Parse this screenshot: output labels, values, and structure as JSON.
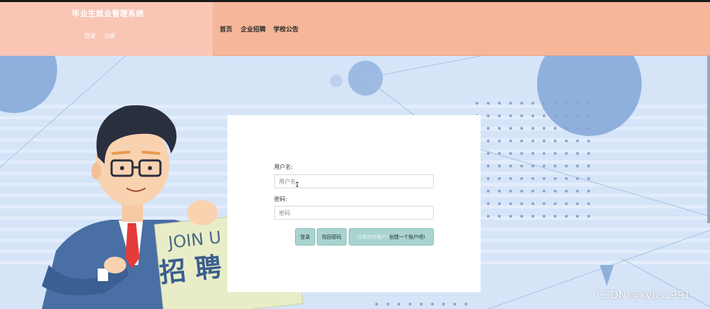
{
  "header": {
    "site_title": "毕业生就业管理系统",
    "auth": {
      "login_label": "登录",
      "register_label": "注册"
    },
    "nav": {
      "home": "首页",
      "jobs": "企业招聘",
      "notices": "学校公告"
    }
  },
  "banner": {
    "sign_text_en": "JOIN U",
    "sign_text_cn": "招 聘"
  },
  "login_form": {
    "username_label": "用户名:",
    "username_placeholder": "用户名",
    "username_value": "",
    "password_label": "密码:",
    "password_placeholder": "密码",
    "password_value": "",
    "login_button": "登录",
    "forgot_button": "找回密码",
    "register_prefix": "没有存在账户?",
    "register_link": "创建一个账户吧!"
  },
  "watermark": "CSDN @kybs1991",
  "colors": {
    "header_bg": "#f6b69a",
    "brand_panel_bg": "#f9c6b6",
    "page_bg": "#d6e4f8",
    "button_bg": "#a9d3cf",
    "card_bg": "#ffffff"
  },
  "icons": {
    "cursor": "text-cursor-icon"
  }
}
